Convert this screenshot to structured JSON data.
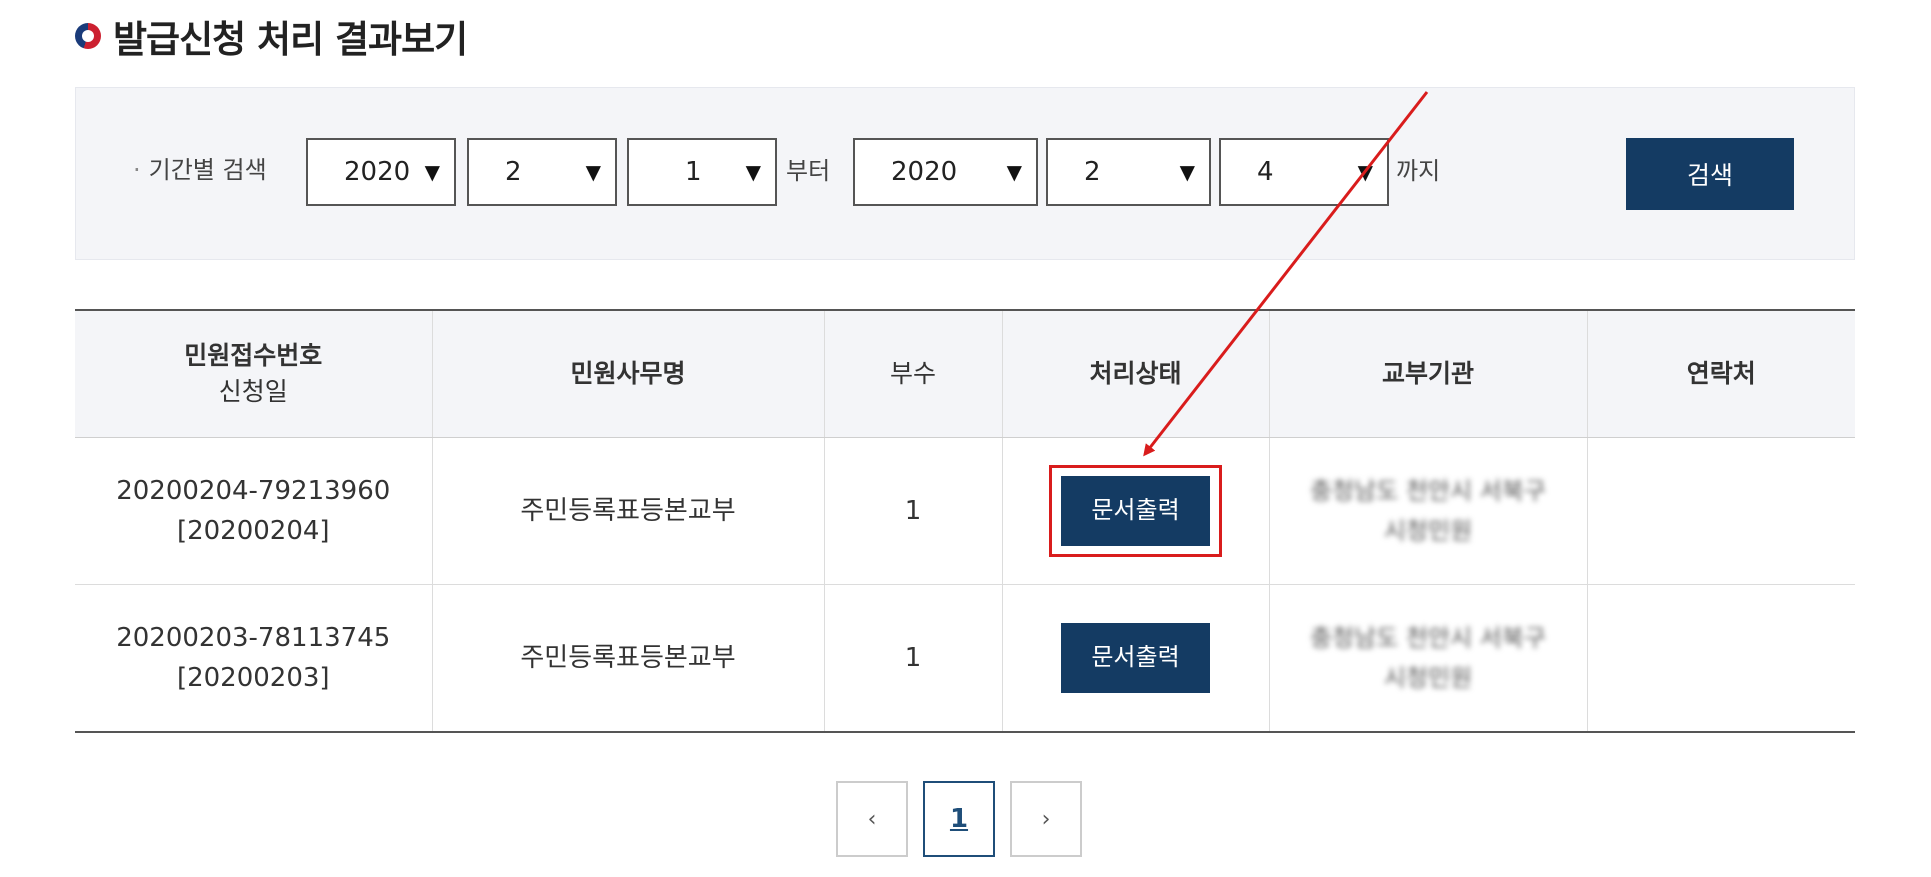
{
  "page": {
    "title": "발급신청 처리 결과보기"
  },
  "search": {
    "label": "기간별 검색",
    "from": {
      "year": "2020",
      "month": "2",
      "day": "1"
    },
    "from_suffix": "부터",
    "to": {
      "year": "2020",
      "month": "2",
      "day": "4"
    },
    "to_suffix": "까지",
    "button": "검색"
  },
  "table": {
    "headers": {
      "receipt_line1": "민원접수번호",
      "receipt_line2": "신청일",
      "name": "민원사무명",
      "copies": "부수",
      "status": "처리상태",
      "agency": "교부기관",
      "contact": "연락처"
    },
    "rows": [
      {
        "receipt_no": "20200204-79213960",
        "date": "[20200204]",
        "name": "주민등록표등본교부",
        "copies": "1",
        "status_button": "문서출력",
        "agency_line1": "충청남도 천안시 서북구",
        "agency_line2": "시청민원"
      },
      {
        "receipt_no": "20200203-78113745",
        "date": "[20200203]",
        "name": "주민등록표등본교부",
        "copies": "1",
        "status_button": "문서출력",
        "agency_line1": "충청남도 천안시 서북구",
        "agency_line2": "시청민원"
      }
    ]
  },
  "pagination": {
    "prev": "‹",
    "current": "1",
    "next": "›"
  },
  "annotation": {
    "arrow_color": "#d91c1c",
    "highlight_color": "#d91c1c"
  },
  "colors": {
    "accent": "#143b63"
  }
}
